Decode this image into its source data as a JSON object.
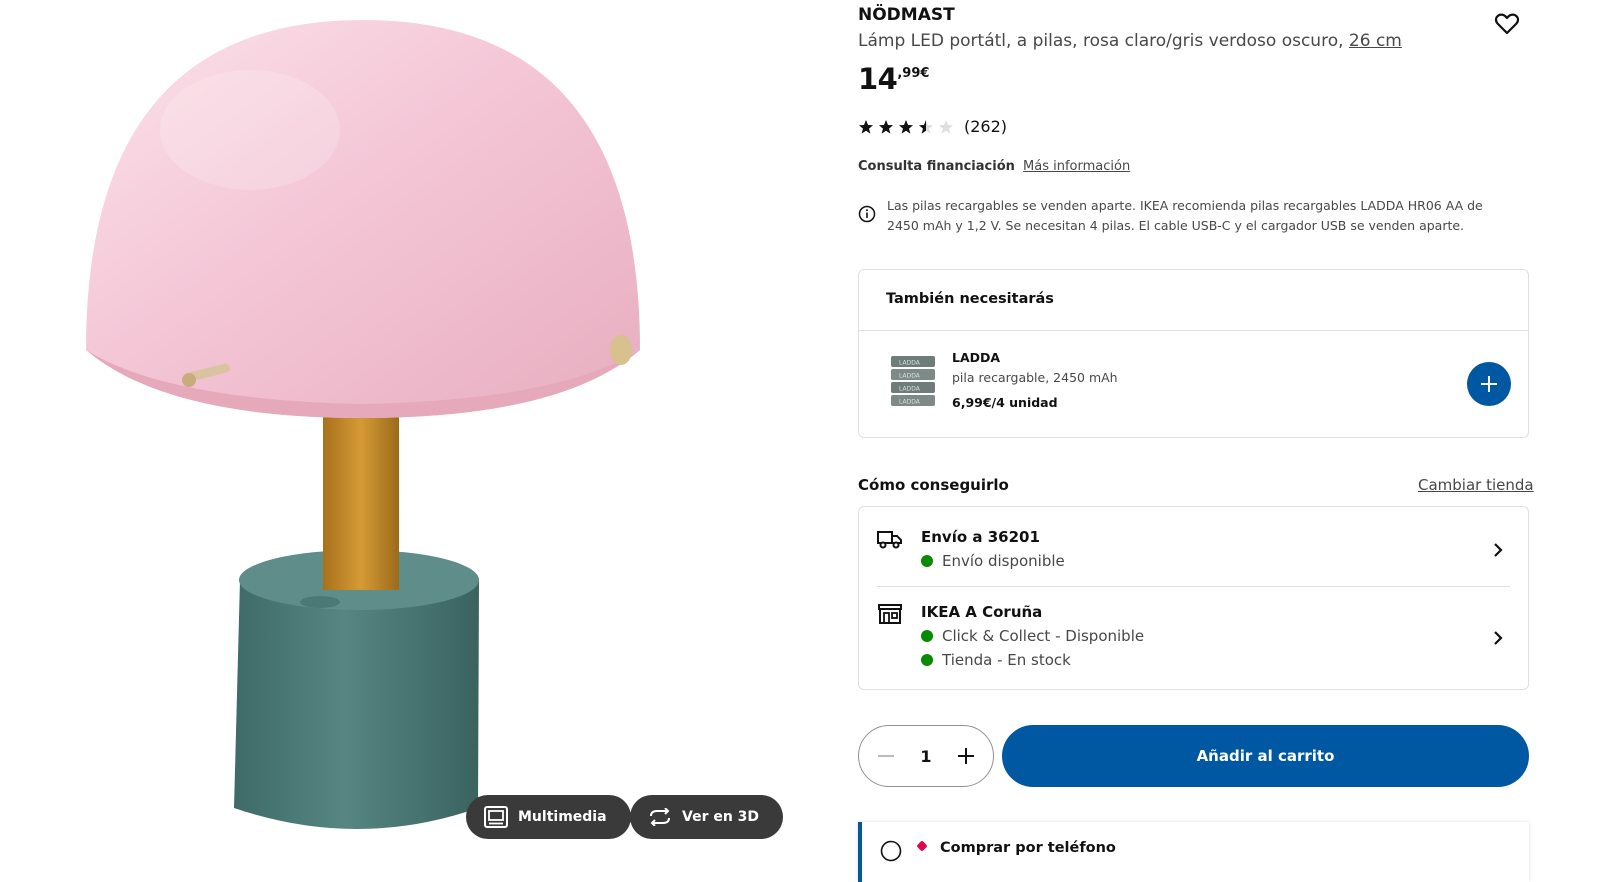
{
  "product": {
    "name": "NÖDMAST",
    "description": "Lámp LED portátl, a pilas, rosa claro/gris verdoso oscuro,",
    "size": "26 cm",
    "price_int": "14",
    "price_dec": ",99€",
    "rating_stars": 3.5,
    "rating_count": "(262)"
  },
  "media": {
    "multimedia_label": "Multimedia",
    "view3d_label": "Ver en 3D"
  },
  "financing": {
    "label": "Consulta financiación",
    "link": "Más información"
  },
  "note": "Las pilas recargables se venden aparte. IKEA recomienda pilas recargables LADDA HR06 AA de 2450 mAh y 1,2 V. Se necesitan 4 pilas. El cable USB-C y el cargador USB se venden aparte.",
  "also_need": {
    "title": "También necesitarás",
    "item": {
      "name": "LADDA",
      "description": "pila recargable, 2450 mAh",
      "price": "6,99€/4 unidad",
      "image_text": "LADDA"
    }
  },
  "how_to_get": {
    "title": "Cómo conseguirlo",
    "change_store": "Cambiar tienda",
    "delivery": {
      "title": "Envío a 36201",
      "status": "Envío disponible"
    },
    "store": {
      "title": "IKEA A Coruña",
      "status1": "Click & Collect - Disponible",
      "status2": "Tienda - En stock"
    }
  },
  "quantity": "1",
  "add_to_cart": "Añadir al carrito",
  "phone_order": "Comprar por teléfono",
  "colors": {
    "accent": "#0058a3",
    "available": "#0a8a00",
    "shade": "#f3c7d6",
    "base": "#4e7d79",
    "stem": "#c8912c"
  },
  "icons": [
    "heart-icon",
    "star-icon",
    "info-icon",
    "plus-icon",
    "truck-icon",
    "store-icon",
    "chevron-right-icon",
    "minus-icon",
    "gallery-icon",
    "rotate-3d-icon",
    "phone-icon"
  ]
}
